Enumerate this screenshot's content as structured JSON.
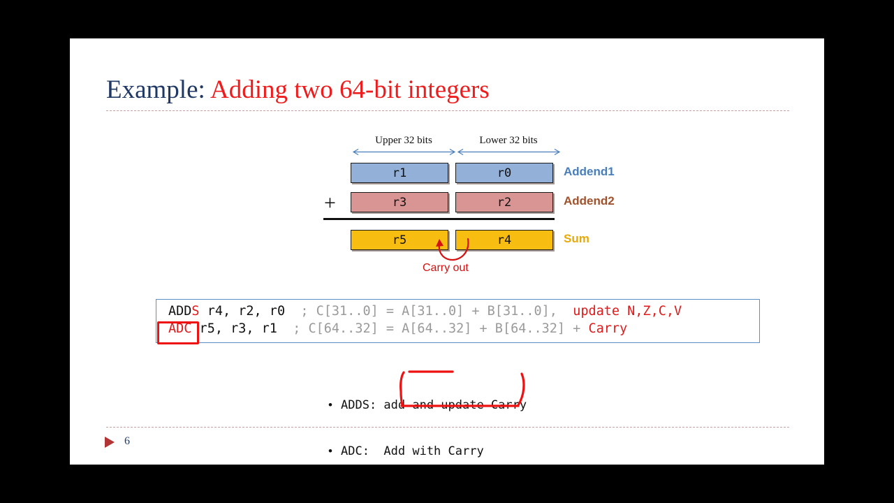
{
  "slide": {
    "title_main": "Example: ",
    "title_accent": "Adding two 64-bit integers",
    "page_number": "6"
  },
  "diagram": {
    "upper_label": "Upper 32 bits",
    "lower_label": "Lower 32 bits",
    "plus_sign": "+",
    "carry_label": "Carry out",
    "rows": [
      {
        "name": "addend1",
        "upper_reg": "r1",
        "lower_reg": "r0",
        "label": "Addend1",
        "color": "#92b0d8",
        "label_color": "#4a7ebb"
      },
      {
        "name": "addend2",
        "upper_reg": "r3",
        "lower_reg": "r2",
        "label": "Addend2",
        "color": "#d99494",
        "label_color": "#a0522d"
      },
      {
        "name": "sum",
        "upper_reg": "r5",
        "lower_reg": "r4",
        "label": "Sum",
        "color": "#f7bd11",
        "label_color": "#e8a90a"
      }
    ]
  },
  "code": {
    "line1": {
      "mnemonic_black": "ADD",
      "mnemonic_red": "S",
      "operands": " r4, r2, r0  ",
      "comment": "; C[31..0] = A[31..0] + B[31..0],  ",
      "comment_highlight": "update N,Z,C,V"
    },
    "line2": {
      "mnemonic_red": "ADC",
      "operands": " r5, r3, r1  ",
      "comment": "; C[64..32] = A[64..32] + B[64..32] + ",
      "comment_highlight": "Carry"
    }
  },
  "bullets": [
    {
      "dot": "•",
      "text": "ADDS: add and update Carry"
    },
    {
      "dot": "•",
      "text": "ADC:  Add with Carry"
    }
  ],
  "colors": {
    "title_blue": "#1f3864",
    "title_red": "#ee1c1c",
    "annotation_red": "#ee1111",
    "code_border_blue": "#5b8fc9",
    "comment_gray": "#9a9a9a"
  }
}
